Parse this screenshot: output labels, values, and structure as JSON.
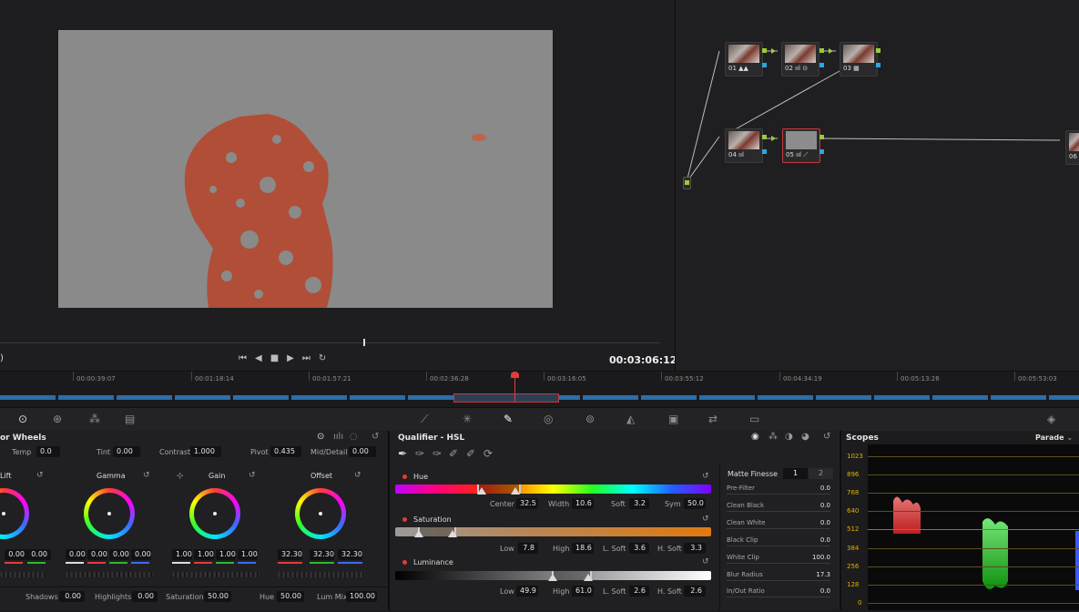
{
  "viewer": {
    "timecode": "00:03:06:12"
  },
  "nodes": [
    {
      "label": "01",
      "icons": "▲▲"
    },
    {
      "label": "02",
      "icons": "ııl ⊙"
    },
    {
      "label": "03",
      "icons": "▦"
    },
    {
      "label": "04",
      "icons": "ııl"
    },
    {
      "label": "05",
      "icons": "ııl ⟋"
    },
    {
      "label": "06",
      "icons": ""
    }
  ],
  "timeline": {
    "ticks": [
      "00:00:39:07",
      "00:01:18:14",
      "00:01:57:21",
      "00:02:36:28",
      "00:03:16:05",
      "00:03:55:12",
      "00:04:34:19",
      "00:05:13:26",
      "00:05:53:03"
    ]
  },
  "color_wheels": {
    "title": "or Wheels",
    "temp_label": "Temp",
    "temp": "0.0",
    "tint_label": "Tint",
    "tint": "0.00",
    "contrast_label": "Contrast",
    "contrast": "1.000",
    "pivot_label": "Pivot",
    "pivot": "0.435",
    "middetail_label": "Mid/Detail",
    "middetail": "0.00",
    "wheels": [
      {
        "name": "Lift",
        "values": [
          "0.00",
          "0.00"
        ]
      },
      {
        "name": "Gamma",
        "values": [
          "0.00",
          "0.00",
          "0.00",
          "0.00"
        ]
      },
      {
        "name": "Gain",
        "values": [
          "1.00",
          "1.00",
          "1.00",
          "1.00"
        ]
      },
      {
        "name": "Offset",
        "values": [
          "32.30",
          "32.30",
          "32.30"
        ]
      }
    ],
    "shadows_label": "Shadows",
    "shadows": "0.00",
    "highlights_label": "Highlights",
    "highlights": "0.00",
    "saturation_label": "Saturation",
    "saturation": "50.00",
    "hue_label": "Hue",
    "hue": "50.00",
    "lummix_label": "Lum Mix",
    "lummix": "100.00"
  },
  "qualifier": {
    "title": "Qualifier - HSL",
    "hue": {
      "label": "Hue",
      "center_label": "Center",
      "center": "32.5",
      "width_label": "Width",
      "width": "10.6",
      "soft_label": "Soft",
      "soft": "3.2",
      "sym_label": "Sym",
      "sym": "50.0"
    },
    "saturation": {
      "label": "Saturation",
      "low_label": "Low",
      "low": "7.8",
      "high_label": "High",
      "high": "18.6",
      "lsoft_label": "L. Soft",
      "lsoft": "3.6",
      "hsoft_label": "H. Soft",
      "hsoft": "3.3"
    },
    "luminance": {
      "label": "Luminance",
      "low_label": "Low",
      "low": "49.9",
      "high_label": "High",
      "high": "61.0",
      "lsoft_label": "L. Soft",
      "lsoft": "2.6",
      "hsoft_label": "H. Soft",
      "hsoft": "2.6"
    }
  },
  "matte_finesse": {
    "title": "Matte Finesse",
    "tab1": "1",
    "tab2": "2",
    "rows": [
      {
        "label": "Pre-Filter",
        "value": "0.0"
      },
      {
        "label": "Clean Black",
        "value": "0.0"
      },
      {
        "label": "Clean White",
        "value": "0.0"
      },
      {
        "label": "Black Clip",
        "value": "0.0"
      },
      {
        "label": "White Clip",
        "value": "100.0"
      },
      {
        "label": "Blur Radius",
        "value": "17.3"
      },
      {
        "label": "In/Out Ratio",
        "value": "0.0"
      }
    ]
  },
  "scopes": {
    "title": "Scopes",
    "mode": "Parade",
    "scale": [
      "1023",
      "896",
      "768",
      "640",
      "512",
      "384",
      "256",
      "128",
      "0"
    ]
  },
  "colors": {
    "accent_red": "#e23b3b",
    "node_green": "#9acd32",
    "node_blue": "#2aa7e0"
  }
}
